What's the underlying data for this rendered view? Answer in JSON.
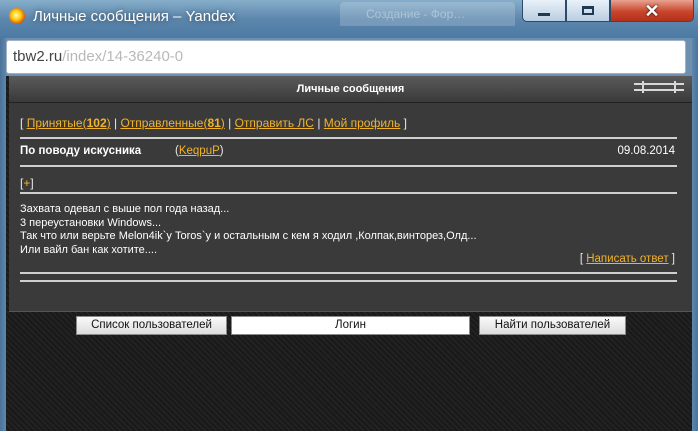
{
  "window": {
    "title": "Личные сообщения – Yandex",
    "background_tab": "Создание - Фор…"
  },
  "address": {
    "host": "tbw2.ru",
    "path": "/index/14-36240-0"
  },
  "panel": {
    "title": "Личные сообщения"
  },
  "nav": {
    "open_bracket": "[",
    "inbox_label": "Принятые(",
    "inbox_count": "102",
    "inbox_close": ")",
    "sep1": " | ",
    "sent_label": "Отправленные(",
    "sent_count": "81",
    "sent_close": ")",
    "sep2": " | ",
    "send_label": "Отправить ЛС",
    "sep3": " | ",
    "profile_label": "Мой профиль",
    "close_bracket": "]"
  },
  "message": {
    "subject": "По поводу искусника",
    "author_open": "(",
    "author": "KeqpuP",
    "author_close": ")",
    "date": "09.08.2014",
    "plus_open": "[",
    "plus": "+",
    "plus_close": "]",
    "lines": [
      "Захвата одевал с выше пол года назад...",
      "3 переустановки Windows...",
      "Так что или верьте Melon4ik`у Toros`у и остальным с кем я ходил ,Колпак,винторез,Олд...",
      "Или вайл бан как хотите...."
    ],
    "reply_open": "[",
    "reply_label": "Написать ответ",
    "reply_close": "]"
  },
  "controls": {
    "userlist_label": "Список пользователей",
    "login_placeholder": "Логин",
    "find_label": "Найти пользователей"
  }
}
